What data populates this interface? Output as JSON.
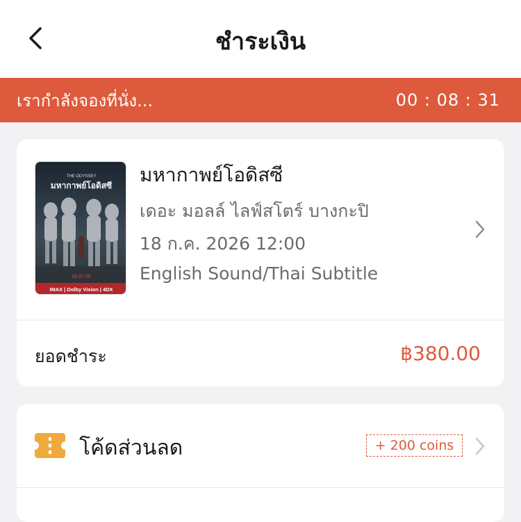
{
  "header": {
    "title": "ชำระเงิน",
    "back_icon": "chevron-left-icon"
  },
  "timer": {
    "message": "เรากำลังจองที่นั่ง...",
    "countdown": "00 : 08 : 31",
    "bar_color": "#de5a3c"
  },
  "movie": {
    "title": "มหากาพย์โอดิสซี",
    "cinema": "เดอะ มอลล์ ไลฟ์สโตร์ บางกะปิ",
    "datetime": "18 ก.ค. 2026 12:00",
    "audio": "English Sound/Thai Subtitle",
    "poster": {
      "title": "มหากาพย์โอดิสซี",
      "title_en": "THE ODYSSEY",
      "date": "16.07.26",
      "formats": "IMAX | Dolby Vision | 4DX"
    }
  },
  "payment": {
    "total_label": "ยอดชำระ",
    "total_value": "฿380.00",
    "accent_color": "#de5a3c"
  },
  "promo": {
    "label": "โค้ดส่วนลด",
    "coins_badge": "+ 200 coins",
    "icon": "coupon-ticket-icon",
    "icon_color": "#f0a93c"
  }
}
